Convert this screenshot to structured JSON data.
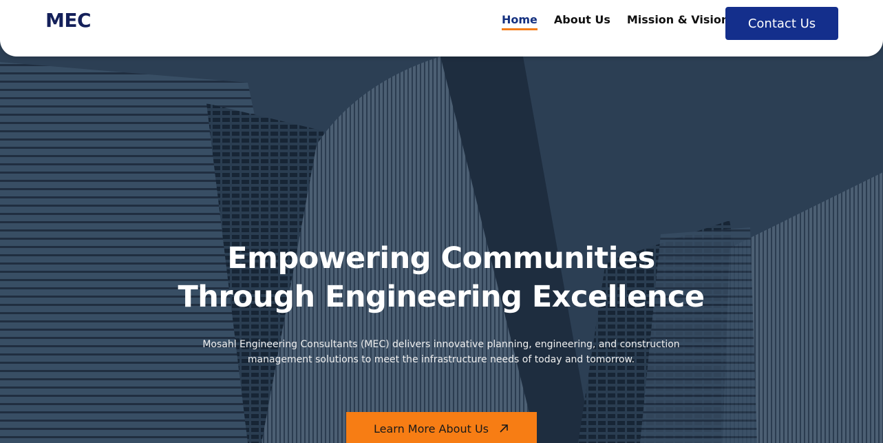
{
  "header": {
    "logo": "MEC",
    "nav": [
      {
        "label": "Home",
        "active": true
      },
      {
        "label": "About Us",
        "active": false
      },
      {
        "label": "Mission & Vision",
        "active": false
      }
    ],
    "contact_label": "Contact Us"
  },
  "hero": {
    "title_line1": "Empowering Communities",
    "title_line2": "Through Engineering Excellence",
    "subtitle": "Mosahl Engineering Consultants (MEC) delivers innovative planning, engineering, and construction management solutions to meet the infrastructure needs of today and tomorrow.",
    "cta_label": "Learn More About Us",
    "cta_icon": "arrow-up-right-icon",
    "background": "skyscrapers-photo"
  },
  "colors": {
    "brand_navy": "#14307f",
    "accent_orange": "#f77d14",
    "nav_background": "#ffffff"
  }
}
